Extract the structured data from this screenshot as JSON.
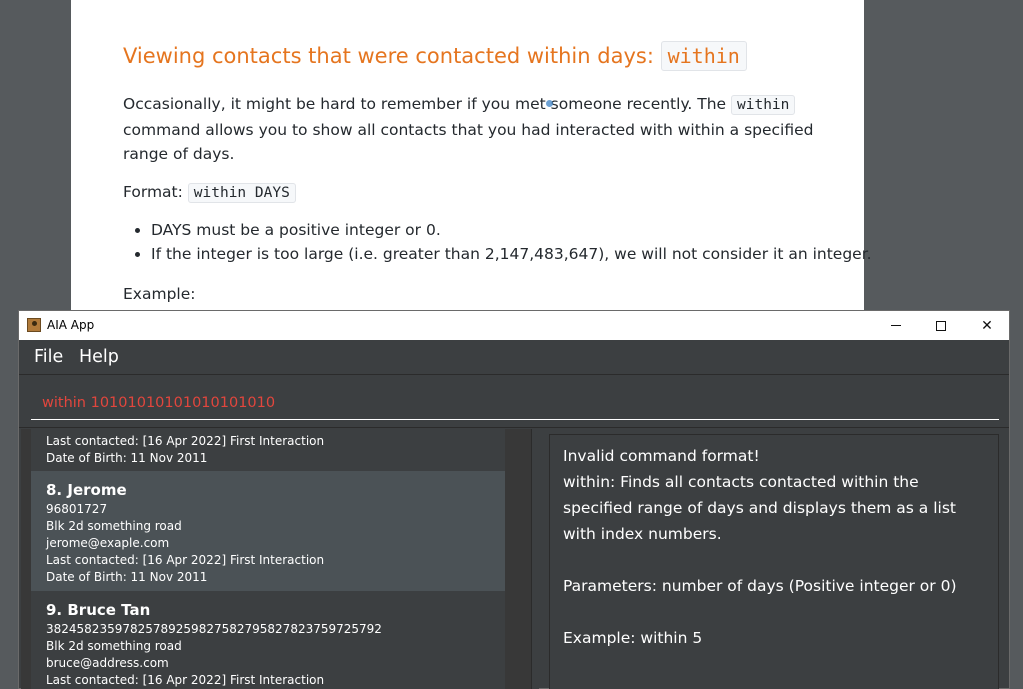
{
  "doc": {
    "title": "Viewing contacts that were contacted within days: ",
    "title_code": "within",
    "para1_before": "Occasionally, it might be hard to remember if you met someone recently. The ",
    "para1_code": "within",
    "para1_after": " command allows you to show all contacts that you had interacted with within a specified range of days.",
    "format_label": "Format: ",
    "format_code": "within DAYS",
    "bullets": [
      "DAYS must be a positive integer or 0.",
      "If the integer is too large (i.e. greater than 2,147,483,647), we will not consider it an integer."
    ],
    "example_label": "Example:"
  },
  "window": {
    "title": "AIA App",
    "min_glyph": "─",
    "close_glyph": "✕"
  },
  "menu": {
    "file": "File",
    "help": "Help"
  },
  "command": {
    "value": "within 10101010101010101010"
  },
  "contacts": [
    {
      "partial": true,
      "last_contacted": "Last contacted: [16 Apr 2022] First Interaction",
      "dob": "Date of Birth: 11 Nov 2011"
    },
    {
      "header": "8.  Jerome",
      "phone": "96801727",
      "address": "Blk 2d something road",
      "email": "jerome@exaple.com",
      "last_contacted": "Last contacted: [16 Apr 2022] First Interaction",
      "dob": "Date of Birth: 11 Nov 2011",
      "selected": true
    },
    {
      "header": "9.  Bruce Tan",
      "phone": "38245823597825789259827582795827823759725792",
      "address": "Blk 2d something road",
      "email": "bruce@address.com",
      "last_contacted": "Last contacted: [16 Apr 2022] First Interaction"
    }
  ],
  "result": {
    "text": "Invalid command format!\nwithin: Finds all contacts contacted within the specified range of days and displays them as a list with index numbers.\n\nParameters: number of days (Positive integer or 0)\n\nExample: within 5"
  }
}
